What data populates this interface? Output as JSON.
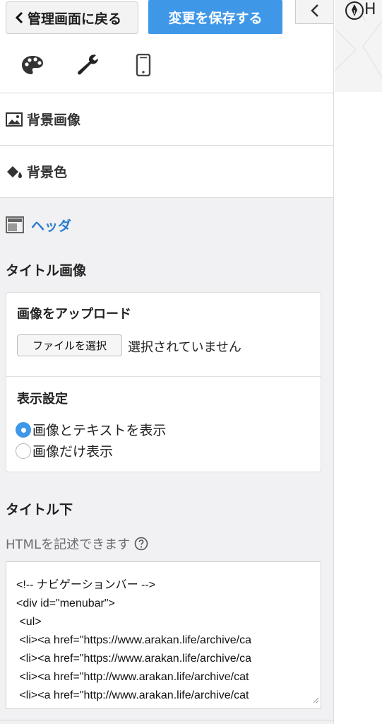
{
  "topbar": {
    "back_label": "管理画面に戻る",
    "save_label": "変更を保存する"
  },
  "tabs": [
    "palette-icon",
    "wrench-icon",
    "mobile-icon"
  ],
  "sections": {
    "background_image": "背景画像",
    "background_color": "背景色",
    "header": "ヘッダ"
  },
  "title_image": {
    "heading": "タイトル画像",
    "upload_label": "画像をアップロード",
    "file_button": "ファイルを選択",
    "file_status": "選択されていません",
    "display_heading": "表示設定",
    "options": [
      {
        "label": "画像とテキストを表示",
        "checked": true
      },
      {
        "label": "画像だけ表示",
        "checked": false
      }
    ]
  },
  "title_below": {
    "heading": "タイトル下",
    "hint": "HTMLを記述できます",
    "code_lines": [
      "<!-- ナビゲーションバー -->",
      "<div id=\"menubar\">",
      " <ul>",
      " <li><a href=\"https://www.arakan.life/archive/ca",
      " <li><a href=\"https://www.arakan.life/archive/ca",
      " <li><a href=\"http://www.arakan.life/archive/cat",
      " <li><a href=\"http://www.arakan.life/archive/cat"
    ]
  },
  "preview": {
    "title_fragment": "H"
  },
  "colors": {
    "accent": "#3f97e8",
    "link": "#2a7ccf",
    "panel_bg": "#f1f1f3"
  }
}
